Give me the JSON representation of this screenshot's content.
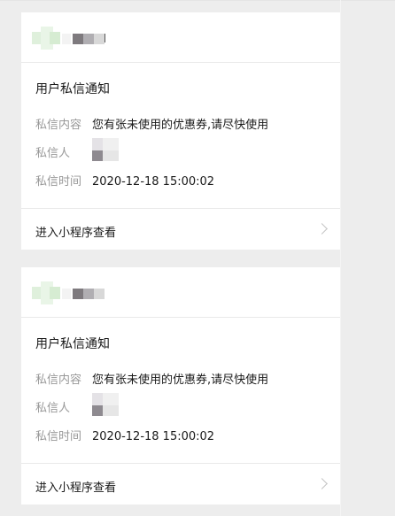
{
  "notifications": [
    {
      "title": "用户私信通知",
      "content_label": "私信内容",
      "content_value": "您有张未使用的优惠券,请尽快使用",
      "sender_label": "私信人",
      "time_label": "私信时间",
      "time_value": "2020-12-18 15:00:02",
      "action_label": "进入小程序查看"
    },
    {
      "title": "用户私信通知",
      "content_label": "私信内容",
      "content_value": "您有张未使用的优惠券,请尽快使用",
      "sender_label": "私信人",
      "time_label": "私信时间",
      "time_value": "2020-12-18 15:00:02",
      "action_label": "进入小程序查看"
    }
  ],
  "icons": {
    "chevron": "chevron-right-icon"
  }
}
